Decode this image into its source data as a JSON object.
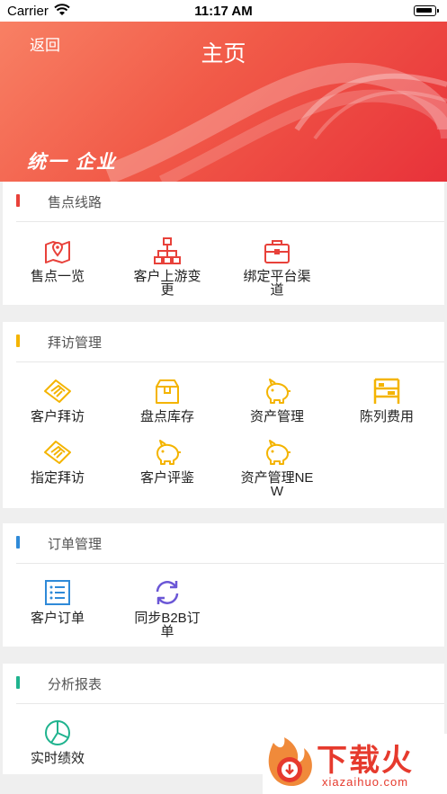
{
  "status_bar": {
    "carrier": "Carrier",
    "time": "11:17 AM"
  },
  "header": {
    "back_label": "返回",
    "title": "主页",
    "brand": "统一 企业"
  },
  "sections": {
    "sales": {
      "title": "售点线路",
      "accent": "#e8413a",
      "items": [
        "售点一览",
        "客户上游变更",
        "绑定平台渠道"
      ]
    },
    "visit": {
      "title": "拜访管理",
      "accent": "#f4b400",
      "items": [
        "客户拜访",
        "盘点库存",
        "资产管理",
        "陈列费用",
        "指定拜访",
        "客户评鉴",
        "资产管理NEW"
      ]
    },
    "order": {
      "title": "订单管理",
      "accent": "#2f8ad8",
      "items": [
        "客户订单",
        "同步B2B订单"
      ]
    },
    "analysis": {
      "title": "分析报表",
      "accent": "#1fb38e",
      "items": [
        "实时绩效"
      ]
    }
  },
  "watermark": {
    "text": "下载火",
    "sub": "xiazaihuo.com"
  },
  "colors": {
    "red": "#e8413a",
    "yellow": "#f4b400",
    "blue": "#2f8ad8",
    "purple": "#6b57d6",
    "teal": "#1fb38e"
  }
}
